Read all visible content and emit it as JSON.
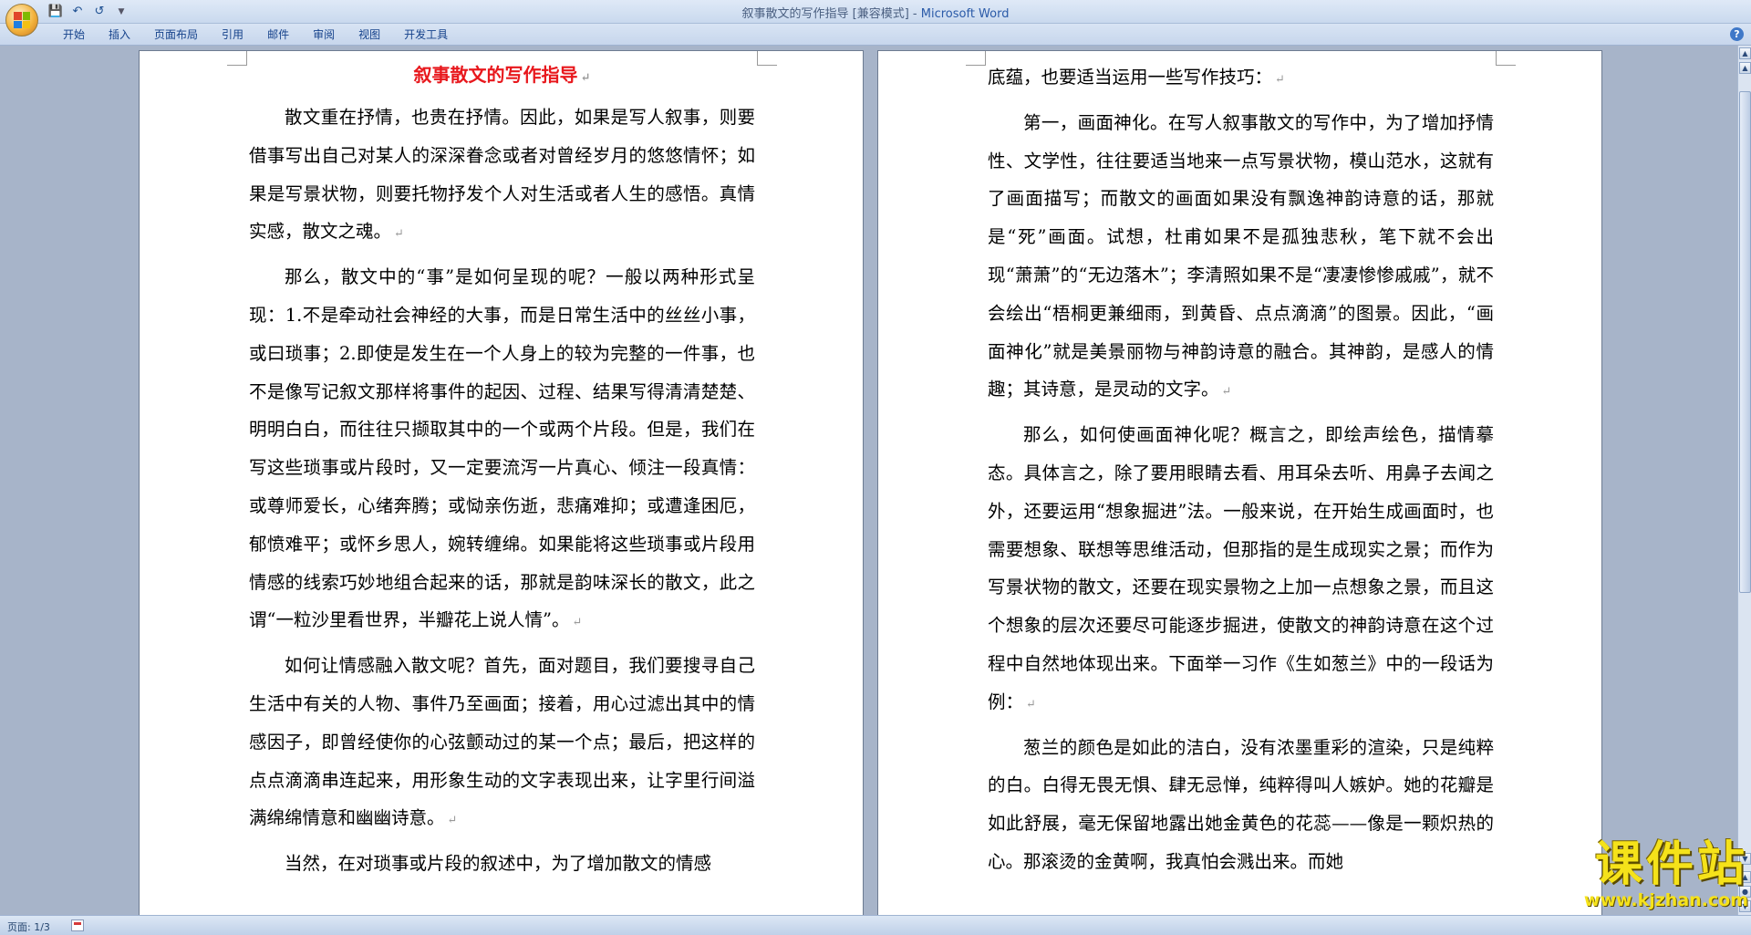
{
  "window": {
    "title": "叙事散文的写作指导 [兼容模式]",
    "separator": " - ",
    "app_name": "Microsoft Word"
  },
  "quick_access": {
    "save_icon": "save-icon",
    "undo_icon": "undo-icon",
    "redo_icon": "redo-icon",
    "customize_icon": "chevron-down-icon"
  },
  "ribbon": {
    "tabs": [
      "开始",
      "插入",
      "页面布局",
      "引用",
      "邮件",
      "审阅",
      "视图",
      "开发工具"
    ],
    "help": "?"
  },
  "document": {
    "title": "叙事散文的写作指导",
    "left_paragraphs": [
      "散文重在抒情，也贵在抒情。因此，如果是写人叙事，则要借事写出自己对某人的深深眷念或者对曾经岁月的悠悠情怀；如果是写景状物，则要托物抒发个人对生活或者人生的感悟。真情实感，散文之魂。",
      "那么，散文中的“事”是如何呈现的呢？一般以两种形式呈现：1.不是牵动社会神经的大事，而是日常生活中的丝丝小事，或曰琐事；2.即使是发生在一个人身上的较为完整的一件事，也不是像写记叙文那样将事件的起因、过程、结果写得清清楚楚、明明白白，而往往只撷取其中的一个或两个片段。但是，我们在写这些琐事或片段时，又一定要流泻一片真心、倾注一段真情：或尊师爱长，心绪奔腾；或恸亲伤逝，悲痛难抑；或遭逢困厄，郁愤难平；或怀乡思人，婉转缠绵。如果能将这些琐事或片段用情感的线索巧妙地组合起来的话，那就是韵味深长的散文，此之谓“一粒沙里看世界，半瓣花上说人情”。",
      "如何让情感融入散文呢？首先，面对题目，我们要搜寻自己生活中有关的人物、事件乃至画面；接着，用心过滤出其中的情感因子，即曾经使你的心弦颤动过的某一个点；最后，把这样的点点滴滴串连起来，用形象生动的文字表现出来，让字里行间溢满绵绵情意和幽幽诗意。",
      "当然，在对琐事或片段的叙述中，为了增加散文的情感"
    ],
    "right_paragraphs": [
      "底蕴，也要适当运用一些写作技巧：",
      "第一，画面神化。在写人叙事散文的写作中，为了增加抒情性、文学性，往往要适当地来一点写景状物，模山范水，这就有了画面描写；而散文的画面如果没有飘逸神韵诗意的话，那就是“死”画面。试想，杜甫如果不是孤独悲秋，笔下就不会出现“萧萧”的“无边落木”；李清照如果不是“凄凄惨惨戚戚”，就不会绘出“梧桐更兼细雨，到黄昏、点点滴滴”的图景。因此，“画面神化”就是美景丽物与神韵诗意的融合。其神韵，是感人的情趣；其诗意，是灵动的文字。",
      "那么，如何使画面神化呢？概言之，即绘声绘色，描情摹态。具体言之，除了要用眼睛去看、用耳朵去听、用鼻子去闻之外，还要运用“想象掘进”法。一般来说，在开始生成画面时，也需要想象、联想等思维活动，但那指的是生成现实之景；而作为写景状物的散文，还要在现实景物之上加一点想象之景，而且这个想象的层次还要尽可能逐步掘进，使散文的神韵诗意在这个过程中自然地体现出来。下面举一习作《生如葱兰》中的一段话为例：",
      "葱兰的颜色是如此的洁白，没有浓墨重彩的渲染，只是纯粹的白。白得无畏无惧、肆无忌惮，纯粹得叫人嫉妒。她的花瓣是如此舒展，毫无保留地露出她金黄色的花蕊——像是一颗炽热的心。那滚烫的金黄啊，我真怕会溅出来。而她"
    ],
    "paragraph_mark": "↵"
  },
  "status": {
    "page": "页面: 1/3"
  },
  "watermark": {
    "main": "课件站",
    "url": "www.kjzhan.com"
  }
}
